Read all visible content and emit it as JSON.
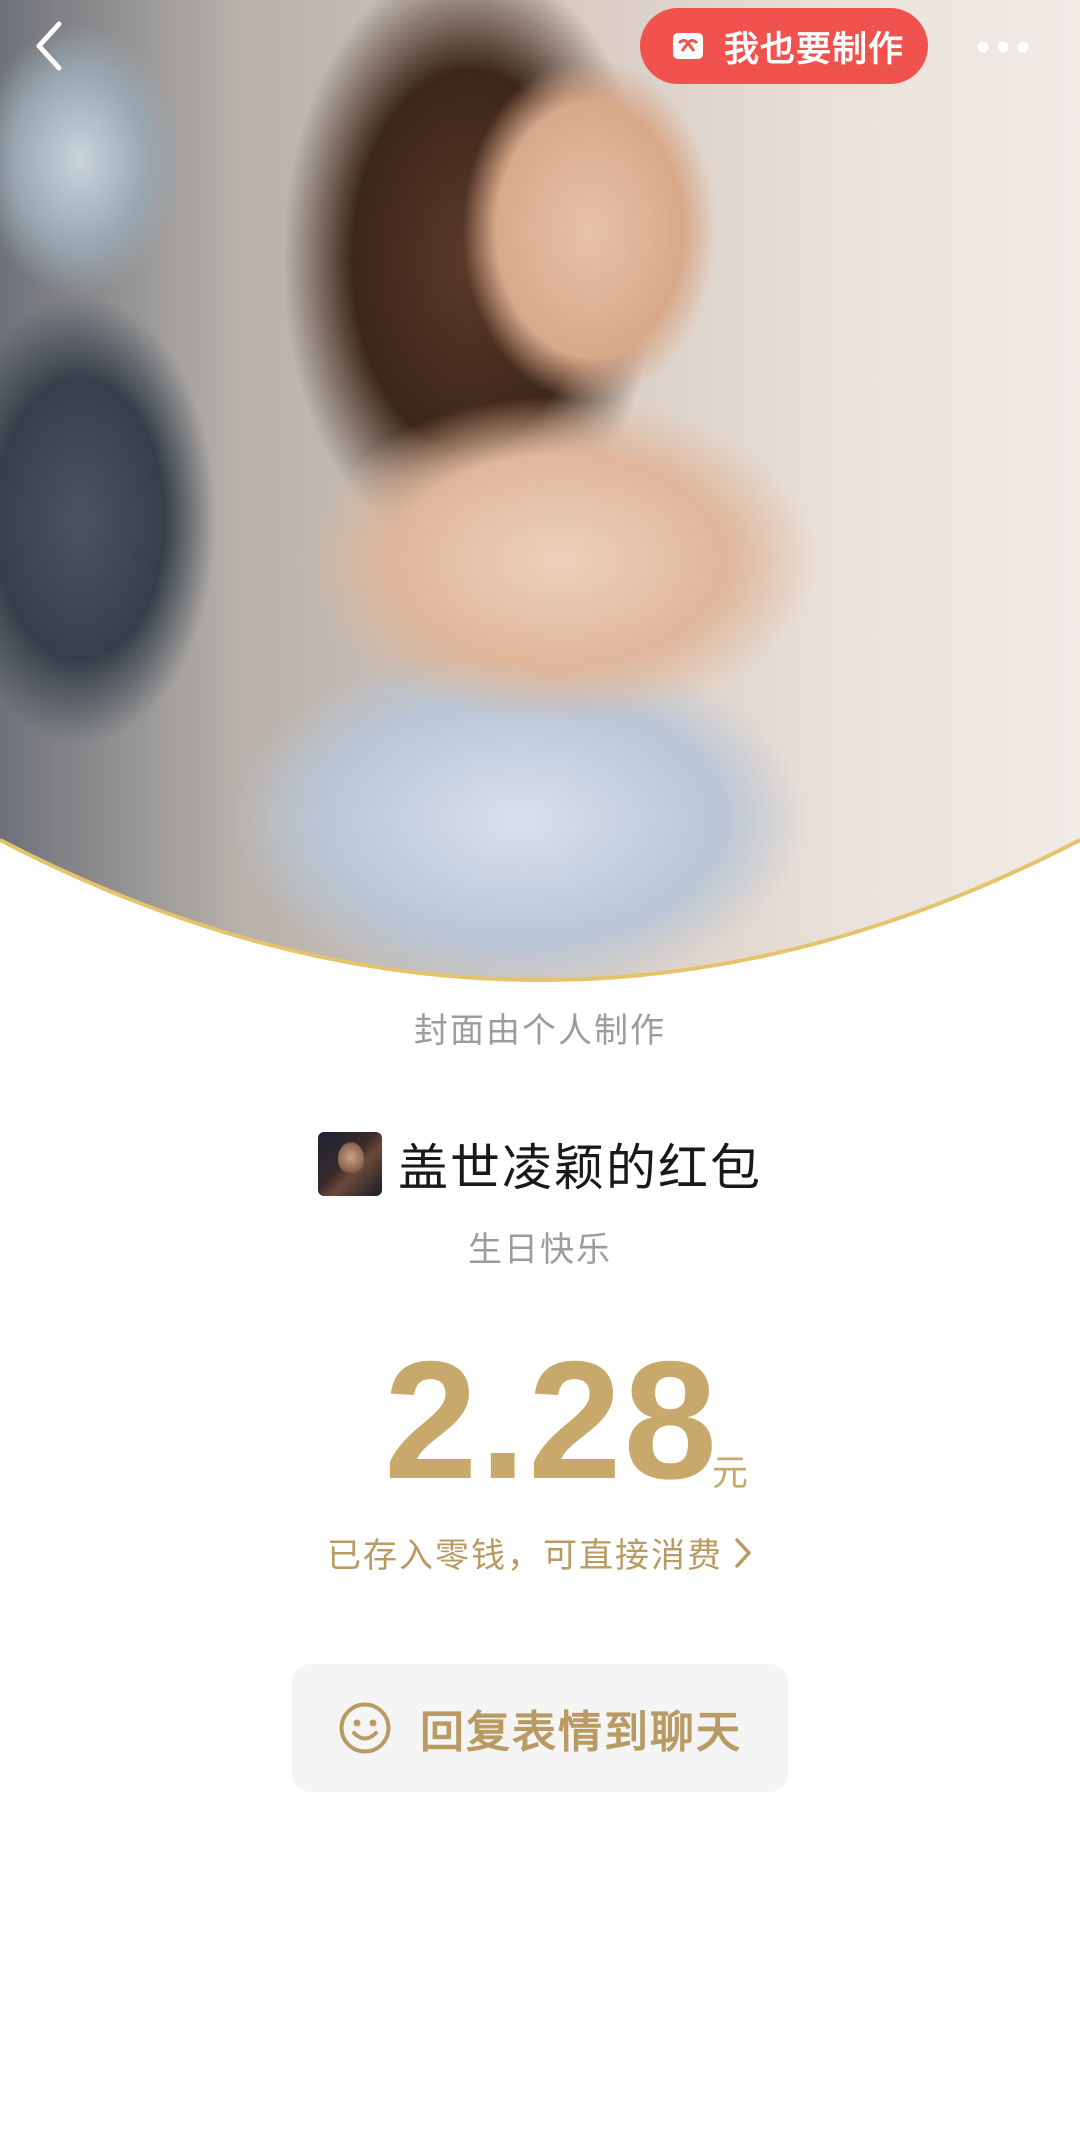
{
  "header": {
    "make_button_label": "我也要制作"
  },
  "cover": {
    "note": "封面由个人制作"
  },
  "envelope": {
    "sender_name": "盖世凌颖的红包",
    "greeting": "生日快乐",
    "amount": "2.28",
    "currency": "元",
    "deposit_text": "已存入零钱，可直接消费"
  },
  "actions": {
    "reply_label": "回复表情到聊天"
  },
  "colors": {
    "gold": "#c8a86b",
    "gold_text": "#b89a62",
    "red_button": "#f0524e",
    "curve_edge": "#e5c36a"
  },
  "icons": {
    "back": "back-chevron-icon",
    "gift": "gift-icon",
    "more": "more-dots-icon",
    "chevron": "chevron-right-icon",
    "smile": "smile-icon"
  }
}
